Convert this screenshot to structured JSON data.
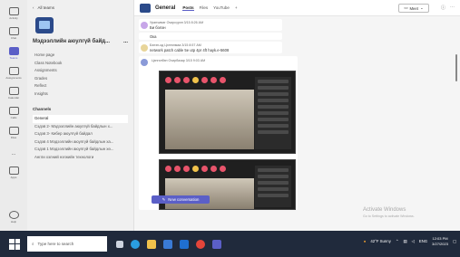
{
  "rail": [
    {
      "label": "Activity",
      "active": false
    },
    {
      "label": "Chat",
      "active": false
    },
    {
      "label": "Teams",
      "active": true
    },
    {
      "label": "Assignments",
      "active": false
    },
    {
      "label": "Calendar",
      "active": false
    },
    {
      "label": "Calls",
      "active": false
    },
    {
      "label": "Files",
      "active": false
    },
    {
      "label": "...",
      "active": false
    },
    {
      "label": "Apps",
      "active": false
    }
  ],
  "rail_help": "Help",
  "teampane": {
    "back": "All teams",
    "title": "Мэдээллийн аюулгүй байд...",
    "more": "...",
    "nav": [
      "Home page",
      "Class Notebook",
      "Assignments",
      "Grades",
      "Reflect",
      "Insights"
    ],
    "channels_header": "Channels",
    "channels": [
      "General",
      "Сэдэв 2- Мэдээллийн аюулгүй байдлын х...",
      "Сэдэв 3- Кибер аюулгүй байдал",
      "Сэдэв 4 Мэдээллийн аюулгүй байдлын ха...",
      "Сэдэв 1 Мэдээллийн аюулгүй байдлын хө...",
      "Англи хэлний нэгжийн технологи"
    ],
    "selected_channel": 0
  },
  "main": {
    "channel_name": "General",
    "tabs": [
      "Posts",
      "Files",
      "YouTube",
      "+"
    ],
    "active_tab": 0,
    "meet_label": "Meet",
    "top_icons": [
      "ⓘ",
      "⋯"
    ],
    "messages": [
      {
        "initials": "УО",
        "meta": "Уранчимэг Очирсүрэн  3/15 8:26 AM",
        "text": "Би бэлэн",
        "color": "#c7a6e8"
      },
      {
        "initials": "",
        "meta": "",
        "text": "Ока",
        "color": "#ffffff"
      },
      {
        "initials": "БЦ",
        "meta": "Бэлэн-од Цэнгэлмаа  3/15 8:57 AM",
        "text": "network patch cable 5e utp 4pr 4ft hayk.e-5608",
        "color": "#e8d59a"
      }
    ],
    "post_meta": "Цэнгэлбэн Очирбазар  3/15 9:03 AM",
    "new_conversation": "New conversation"
  },
  "watermark": {
    "title": "Activate Windows",
    "sub": "Go to Settings to activate Windows."
  },
  "taskbar": {
    "search_placeholder": "Type here to search",
    "weather": "42°F Sunny",
    "lang": "ENG",
    "time": "12:03 PM",
    "date": "3/27/2023"
  },
  "colors": {
    "accent": "#5b5fc7",
    "taskbar": "#202a3c"
  }
}
